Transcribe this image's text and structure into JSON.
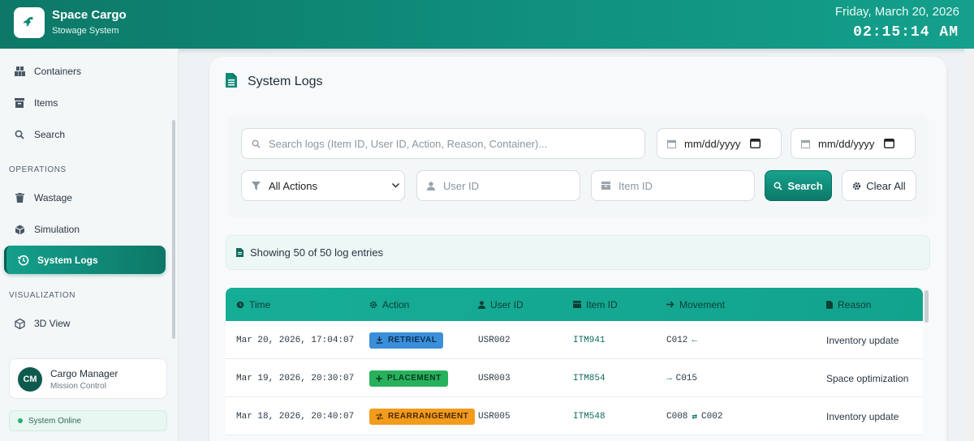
{
  "header": {
    "app_title": "Space Cargo",
    "app_subtitle": "Stowage System",
    "date": "Friday, March 20, 2026",
    "time": "02:15:14 AM"
  },
  "sidebar": {
    "items": [
      {
        "label": "Containers",
        "icon": "containers-icon"
      },
      {
        "label": "Items",
        "icon": "archive-icon"
      },
      {
        "label": "Search",
        "icon": "search-icon"
      }
    ],
    "operations_label": "OPERATIONS",
    "operations": [
      {
        "label": "Wastage",
        "icon": "trash-icon"
      },
      {
        "label": "Simulation",
        "icon": "cube-icon"
      },
      {
        "label": "System Logs",
        "icon": "history-icon",
        "active": true
      }
    ],
    "visualization_label": "VISUALIZATION",
    "visualization": [
      {
        "label": "3D View",
        "icon": "cube-icon"
      }
    ],
    "user": {
      "initials": "CM",
      "name": "Cargo Manager",
      "role": "Mission Control"
    },
    "status": "System Online"
  },
  "page": {
    "title": "System Logs",
    "filters": {
      "search_placeholder": "Search logs (Item ID, User ID, Action, Reason, Container)...",
      "date_from": "mm/dd/yyyy",
      "date_to": "mm/dd/yyyy",
      "action_select": "All Actions",
      "user_placeholder": "User ID",
      "item_placeholder": "Item ID",
      "search_button": "Search",
      "clear_button": "Clear All"
    },
    "count_text": "Showing 50 of 50 log entries",
    "table": {
      "headers": [
        "Time",
        "Action",
        "User ID",
        "Item ID",
        "Movement",
        "Reason"
      ],
      "rows": [
        {
          "time": "Mar 20, 2026, 17:04:07",
          "action": "RETRIEVAL",
          "action_color": "#3b8fd9",
          "user": "USR002",
          "item": "ITM941",
          "from": "C012",
          "arrow": "←",
          "to": "",
          "reason": "Inventory update"
        },
        {
          "time": "Mar 19, 2026, 20:30:07",
          "action": "PLACEMENT",
          "action_color": "#27b15c",
          "user": "USR003",
          "item": "ITM854",
          "from": "",
          "arrow": "→",
          "to": "C015",
          "reason": "Space optimization"
        },
        {
          "time": "Mar 18, 2026, 20:40:07",
          "action": "REARRANGEMENT",
          "action_color": "#f29b1d",
          "user": "USR005",
          "item": "ITM548",
          "from": "C008",
          "arrow": "⇄",
          "to": "C002",
          "reason": "Inventory update"
        }
      ]
    }
  },
  "colors": {
    "accent": "#10927f",
    "accent_dark": "#0d7767"
  }
}
